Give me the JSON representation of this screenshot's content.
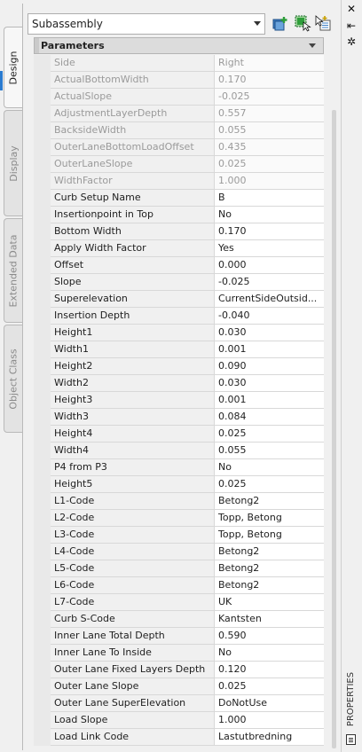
{
  "left_tabs": [
    {
      "label": "Design",
      "active": true
    },
    {
      "label": "Display",
      "active": false
    },
    {
      "label": "Extended Data",
      "active": false
    },
    {
      "label": "Object Class",
      "active": false
    }
  ],
  "window_controls": {
    "close": "✕",
    "pin": "⇤",
    "settings": "✲"
  },
  "selector": {
    "value": "Subassembly"
  },
  "toolbar": {
    "icons": [
      "quick-select-icon",
      "select-objects-icon",
      "pickadd-toggle-icon"
    ]
  },
  "section": {
    "title": "Parameters"
  },
  "properties": [
    {
      "name": "Side",
      "value": "Right",
      "readonly": true
    },
    {
      "name": "ActualBottomWidth",
      "value": "0.170",
      "readonly": true
    },
    {
      "name": "ActualSlope",
      "value": "-0.025",
      "readonly": true
    },
    {
      "name": "AdjustmentLayerDepth",
      "value": "0.557",
      "readonly": true
    },
    {
      "name": "BacksideWidth",
      "value": "0.055",
      "readonly": true
    },
    {
      "name": "OuterLaneBottomLoadOffset",
      "value": "0.435",
      "readonly": true
    },
    {
      "name": "OuterLaneSlope",
      "value": "0.025",
      "readonly": true
    },
    {
      "name": "WidthFactor",
      "value": "1.000",
      "readonly": true
    },
    {
      "name": "Curb Setup Name",
      "value": "B",
      "readonly": false
    },
    {
      "name": "Insertionpoint in Top",
      "value": "No",
      "readonly": false
    },
    {
      "name": "Bottom Width",
      "value": "0.170",
      "readonly": false
    },
    {
      "name": "Apply Width Factor",
      "value": "Yes",
      "readonly": false
    },
    {
      "name": "Offset",
      "value": "0.000",
      "readonly": false
    },
    {
      "name": "Slope",
      "value": "-0.025",
      "readonly": false
    },
    {
      "name": "Superelevation",
      "value": "CurrentSideOutsid...",
      "readonly": false
    },
    {
      "name": "Insertion Depth",
      "value": "-0.040",
      "readonly": false
    },
    {
      "name": "Height1",
      "value": "0.030",
      "readonly": false
    },
    {
      "name": "Width1",
      "value": "0.001",
      "readonly": false
    },
    {
      "name": "Height2",
      "value": "0.090",
      "readonly": false
    },
    {
      "name": "Width2",
      "value": "0.030",
      "readonly": false
    },
    {
      "name": "Height3",
      "value": "0.001",
      "readonly": false
    },
    {
      "name": "Width3",
      "value": "0.084",
      "readonly": false
    },
    {
      "name": "Height4",
      "value": "0.025",
      "readonly": false
    },
    {
      "name": "Width4",
      "value": "0.055",
      "readonly": false
    },
    {
      "name": "P4 from P3",
      "value": "No",
      "readonly": false
    },
    {
      "name": "Height5",
      "value": "0.025",
      "readonly": false
    },
    {
      "name": "L1-Code",
      "value": "Betong2",
      "readonly": false
    },
    {
      "name": "L2-Code",
      "value": "Topp, Betong",
      "readonly": false
    },
    {
      "name": "L3-Code",
      "value": "Topp, Betong",
      "readonly": false
    },
    {
      "name": "L4-Code",
      "value": "Betong2",
      "readonly": false
    },
    {
      "name": "L5-Code",
      "value": "Betong2",
      "readonly": false
    },
    {
      "name": "L6-Code",
      "value": "Betong2",
      "readonly": false
    },
    {
      "name": "L7-Code",
      "value": "UK",
      "readonly": false
    },
    {
      "name": "Curb S-Code",
      "value": "Kantsten",
      "readonly": false
    },
    {
      "name": "Inner Lane Total Depth",
      "value": "0.590",
      "readonly": false
    },
    {
      "name": "Inner Lane To Inside",
      "value": "No",
      "readonly": false
    },
    {
      "name": "Outer Lane Fixed Layers Depth",
      "value": "0.120",
      "readonly": false
    },
    {
      "name": "Outer Lane Slope",
      "value": "0.025",
      "readonly": false
    },
    {
      "name": "Outer Lane SuperElevation",
      "value": "DoNotUse",
      "readonly": false
    },
    {
      "name": "Load Slope",
      "value": "1.000",
      "readonly": false
    },
    {
      "name": "Load Link Code",
      "value": "Lastutbredning",
      "readonly": false
    }
  ],
  "palette_title": "PROPERTIES",
  "colors": {
    "accent": "#2a7bd0",
    "readonly_text": "#9a9a9a",
    "icon_green": "#2e9e3a"
  }
}
